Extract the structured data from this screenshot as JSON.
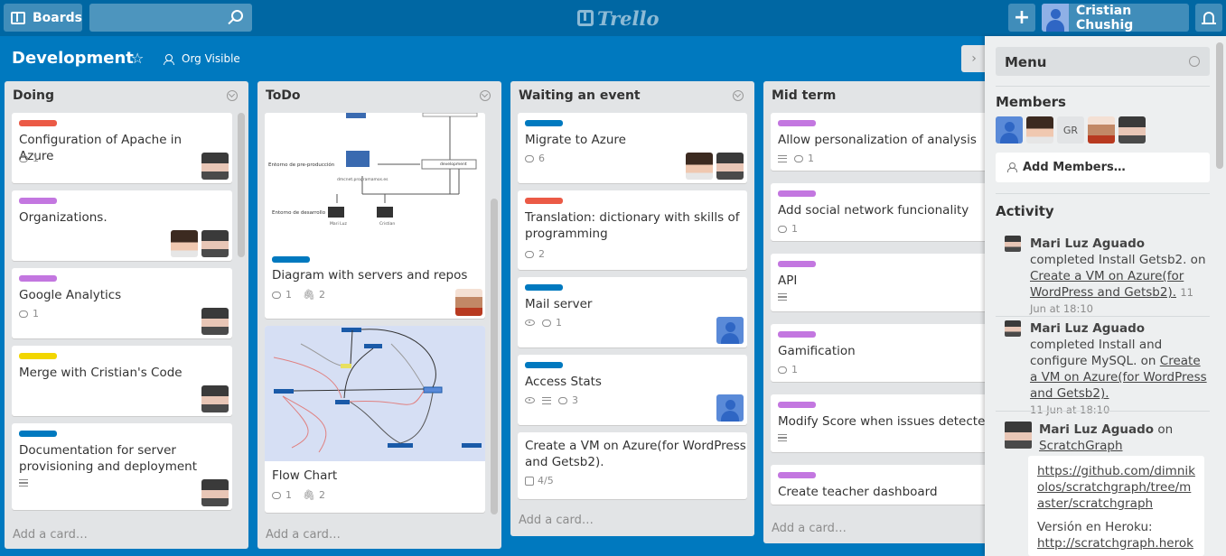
{
  "header": {
    "boards_label": "Boards",
    "search_value": "",
    "logo_text": "Trello",
    "add_label": "+",
    "user_name": "Cristian Chushig"
  },
  "board": {
    "title": "Development",
    "star": "☆",
    "visibility": "Org Visible",
    "collapse": "›"
  },
  "lists": [
    {
      "name": "Doing",
      "add_card": "Add a card…",
      "cards": [
        {
          "label": "red",
          "title": "Configuration of Apache in Azure",
          "comments": "1"
        },
        {
          "label": "purple",
          "title": "Organizations."
        },
        {
          "label": "purple",
          "title": "Google Analytics",
          "comments": "1"
        },
        {
          "label": "yellow",
          "title": "Merge with Cristian's Code"
        },
        {
          "label": "blue",
          "title": "Documentation for server provisioning and deployment",
          "description": true
        }
      ]
    },
    {
      "name": "ToDo",
      "add_card": "Add a card…",
      "cards": [
        {
          "label": "blue",
          "title": "Diagram with servers and repos",
          "comments": "1",
          "attachments": "2",
          "cover": {
            "top_text": "Entorno de producción",
            "pre_label": "Entorno de pre-producción",
            "dev_label": "Entorno de desarrollo",
            "host_a": "dmcnet.programamos.es",
            "host_b": "dmcnet.programamos.es",
            "repo_label": "development",
            "user_a": "Mari Luz",
            "user_b": "Cristian"
          }
        },
        {
          "title": "Flow Chart",
          "comments": "1",
          "attachments": "2"
        }
      ]
    },
    {
      "name": "Waiting an event",
      "add_card": "Add a card…",
      "cards": [
        {
          "label": "blue",
          "title": "Migrate to Azure",
          "comments": "6"
        },
        {
          "label": "red",
          "title": "Translation: dictionary with skills of programming",
          "comments": "2"
        },
        {
          "label": "blue",
          "title": "Mail server",
          "comments": "1"
        },
        {
          "label": "blue",
          "title": "Access Stats",
          "comments": "3"
        },
        {
          "title": "Create a VM on Azure(for WordPress and Getsb2).",
          "checklist": "4/5"
        }
      ]
    },
    {
      "name": "Mid term",
      "add_card": "Add a card…",
      "cards": [
        {
          "label": "purple",
          "title": "Allow personalization of analysis",
          "comments": "1"
        },
        {
          "label": "purple",
          "title": "Add social network funcionality",
          "comments": "1"
        },
        {
          "label": "purple",
          "title": "API"
        },
        {
          "label": "purple",
          "title": "Gamification",
          "comments": "1"
        },
        {
          "label": "purple",
          "title": "Modify Score when issues detected"
        },
        {
          "label": "purple",
          "title": "Create teacher dashboard"
        }
      ]
    }
  ],
  "menu": {
    "title": "Menu",
    "members_title": "Members",
    "member_initials": "GR",
    "add_members": "Add Members…",
    "activity_title": "Activity",
    "activity": [
      {
        "who": "Mari Luz Aguado",
        "action": " completed Install Getsb2. on ",
        "link": "Create a VM on Azure(for WordPress and Getsb2).",
        "when": "11 Jun at 18:10"
      },
      {
        "who": "Mari Luz Aguado",
        "action": " completed Install and configure MySQL. on ",
        "link": "Create a VM on Azure(for WordPress and Getsb2).",
        "when": "11 Jun at 18:10"
      },
      {
        "who": "Mari Luz Aguado",
        "action": " on ",
        "link": "ScratchGraph",
        "when": ""
      }
    ],
    "attachment": {
      "url": "https://github.com/dimnikolos/scratchgraph/tree/master/scratchgraph",
      "heroku_label": "Versión en Heroku:",
      "heroku_url": "http://scratchgraph.heroku"
    }
  },
  "colors": {
    "brand": "#0079bf",
    "header": "#0067a3",
    "label_red": "#eb5a46",
    "label_purple": "#c377e0",
    "label_yellow": "#f2d600",
    "label_blue": "#0079bf"
  }
}
